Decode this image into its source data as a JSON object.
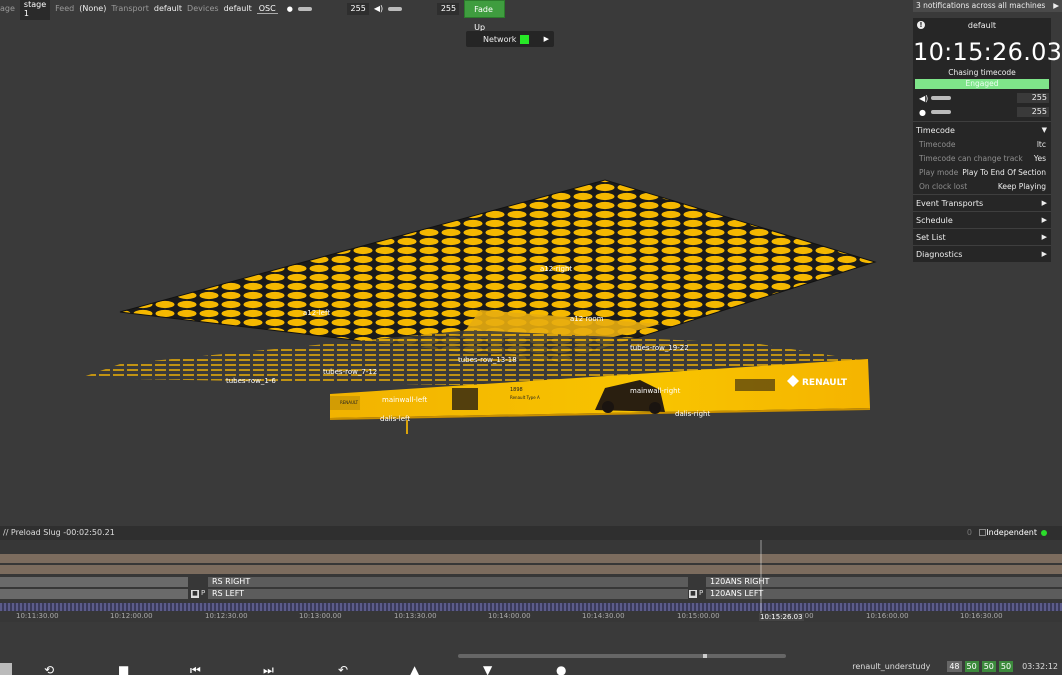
{
  "toolbar": {
    "stage_label": "age",
    "stage_value": "stage 1",
    "feed_label": "Feed",
    "feed_value": "(None)",
    "transport_label": "Transport",
    "transport_value": "default",
    "devices_label": "Devices",
    "devices_value": "default",
    "osc_label": "OSC",
    "level_value": "255",
    "volume_value": "255",
    "fade_up_label": "Fade Up"
  },
  "network": {
    "label": "Network"
  },
  "notifications": {
    "text": "3 notifications across all machines"
  },
  "panel": {
    "transport_name": "default",
    "clock": "10:15:26.03",
    "status": "Chasing timecode",
    "engaged": "Engaged",
    "level_value": "255",
    "volume_value": "255",
    "timecode_section": "Timecode",
    "props": [
      {
        "key": "Timecode",
        "value": "ltc"
      },
      {
        "key": "Timecode can change track",
        "value": "Yes"
      },
      {
        "key": "Play mode",
        "value": "Play To End Of Section"
      },
      {
        "key": "On clock lost",
        "value": "Keep Playing"
      }
    ],
    "sections": [
      "Event Transports",
      "Schedule",
      "Set List",
      "Diagnostics"
    ]
  },
  "stage": {
    "labels": {
      "a12_right": "a12-right",
      "a12_left": "a12-left",
      "a12_room": "a12 room",
      "tubes_1_6": "tubes-row_1-6",
      "tubes_7_12": "tubes-row_7-12",
      "tubes_13_18": "tubes-row_13-18",
      "tubes_19_22": "tubes-row_19-22",
      "mainwall_left": "mainwall-left",
      "mainwall_right": "mainwall-right",
      "dalis_left": "dalis-left",
      "dalis_right": "dalis-right",
      "brand": "RENAULT",
      "brand_small": "RENAULT",
      "year": "1898",
      "model": "Renault\nType A"
    }
  },
  "timeline": {
    "slug": "// Preload Slug -00:02:50.21",
    "mode": "Independent",
    "zero": "0",
    "tracks": {
      "rs_right": "RS RIGHT",
      "rs_left": "RS LEFT",
      "ans_right": "120ANS RIGHT",
      "ans_left": "120ANS LEFT"
    },
    "p": "P",
    "ticks": [
      "10:11:30.00",
      "10:12:00.00",
      "10:12:30.00",
      "10:13:00.00",
      "10:13:30.00",
      "10:14:00.00",
      "10:14:30.00",
      "10:15:00.00",
      "10:15:30.00",
      "10:16:00.00",
      "10:16:30.00"
    ],
    "playhead_time": "10:15:26.03"
  },
  "status": {
    "project": "renault_understudy",
    "counts": [
      "48",
      "50",
      "50",
      "50"
    ],
    "clock": "03:32:12"
  },
  "colors": {
    "accent_green": "#3f9d3f",
    "led_green": "#27e827",
    "stage_yellow": "#f5b800"
  }
}
